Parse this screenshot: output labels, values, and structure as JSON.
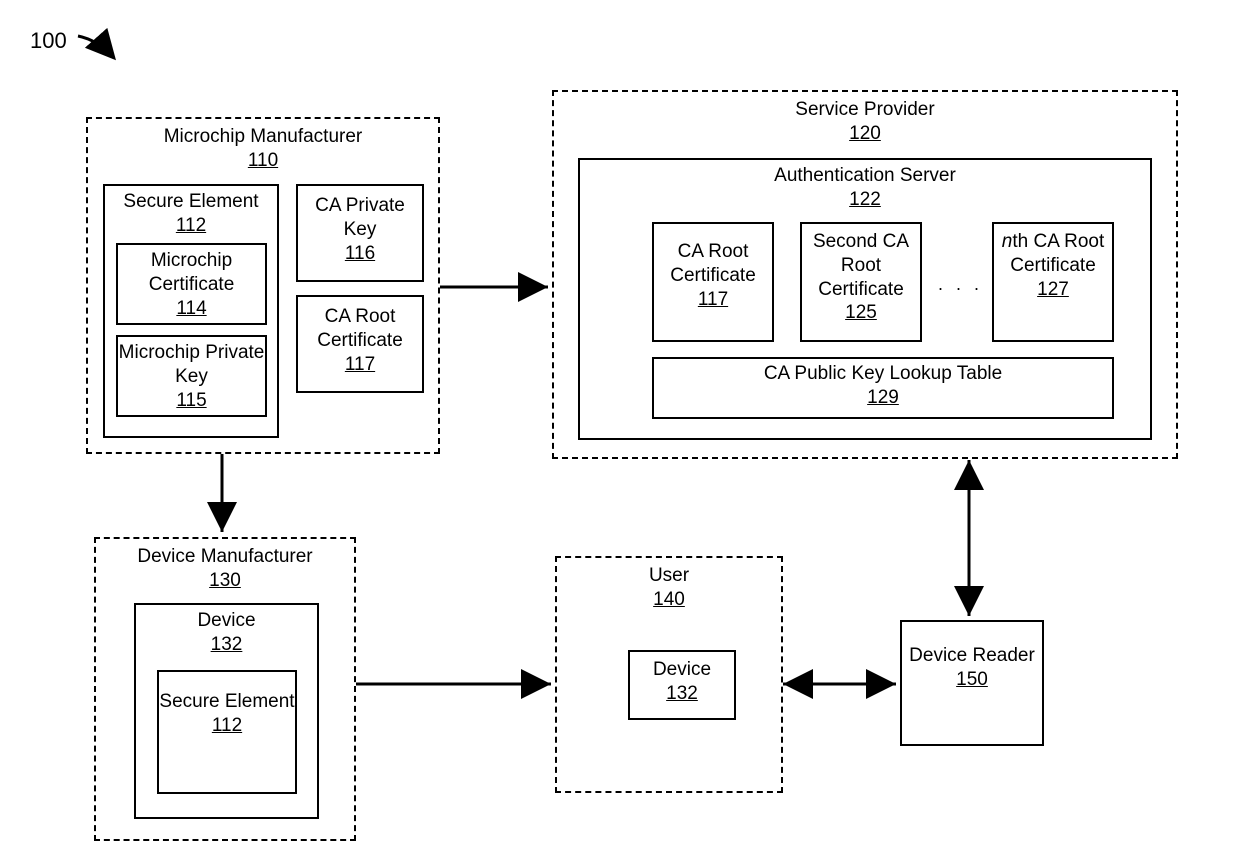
{
  "figure": {
    "number": "100"
  },
  "microchip_mfg": {
    "title": "Microchip Manufacturer",
    "num": "110",
    "secure_element": {
      "title": "Secure Element",
      "num": "112",
      "cert": {
        "title": "Microchip Certificate",
        "num": "114"
      },
      "pkey": {
        "title": "Microchip Private Key",
        "num": "115"
      }
    },
    "ca_priv": {
      "title": "CA Private Key",
      "num": "116"
    },
    "ca_root": {
      "title": "CA Root Certificate",
      "num": "117"
    }
  },
  "service_provider": {
    "title": "Service Provider",
    "num": "120",
    "auth_server": {
      "title": "Authentication Server",
      "num": "122",
      "cert1": {
        "title": "CA Root Certificate",
        "num": "117"
      },
      "cert2": {
        "title": "Second CA Root Certificate",
        "num": "125"
      },
      "certn": {
        "prefix": "n",
        "suffix": "th CA Root Certificate",
        "num": "127"
      },
      "lookup": {
        "title": "CA Public Key Lookup Table",
        "num": "129"
      }
    }
  },
  "device_mfg": {
    "title": "Device Manufacturer",
    "num": "130",
    "device": {
      "title": "Device",
      "num": "132",
      "se": {
        "title": "Secure Element",
        "num": "112"
      }
    }
  },
  "user": {
    "title": "User",
    "num": "140",
    "device": {
      "title": "Device",
      "num": "132"
    }
  },
  "reader": {
    "title": "Device Reader",
    "num": "150"
  }
}
